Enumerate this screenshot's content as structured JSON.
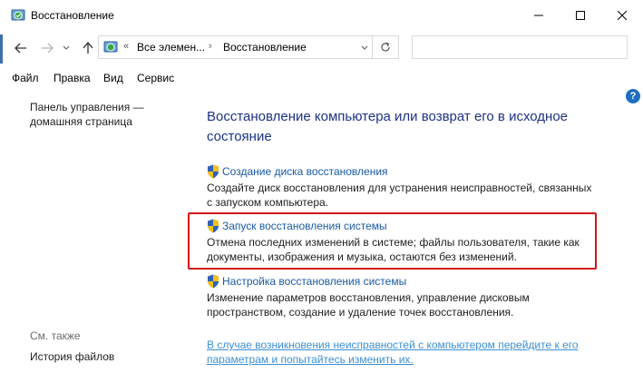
{
  "window": {
    "title": "Восстановление"
  },
  "address": {
    "crumb1": "Все элемен...",
    "crumb2": "Восстановление",
    "prefix": "«",
    "separator": "›"
  },
  "menu": [
    "Файл",
    "Правка",
    "Вид",
    "Сервис"
  ],
  "sidebar": {
    "home_link": "Панель управления — домашняя страница",
    "see_also": "См. также",
    "history": "История файлов"
  },
  "main": {
    "title": "Восстановление компьютера или возврат его в исходное состояние",
    "tasks": [
      {
        "link": "Создание диска восстановления",
        "desc": "Создайте диск восстановления для устранения неисправностей, связанных с запуском компьютера."
      },
      {
        "link": "Запуск восстановления системы",
        "desc": "Отмена последних изменений в системе; файлы пользователя, такие как документы, изображения и музыка, остаются без изменений."
      },
      {
        "link": "Настройка восстановления системы",
        "desc": "Изменение параметров восстановления, управление дисковым пространством, создание и удаление точек восстановления."
      }
    ],
    "bottom_link": "В случае возникновения неисправностей с компьютером перейдите к его параметрам и попытайтесь изменить их."
  },
  "icons": {
    "app": "control-panel-recovery-icon",
    "shield": "uac-shield-icon",
    "help": "help-icon"
  },
  "colors": {
    "title": "#1e3287",
    "link": "#1a5aa5",
    "bottom_link": "#3c8fd6",
    "highlight": "#d3141b"
  }
}
